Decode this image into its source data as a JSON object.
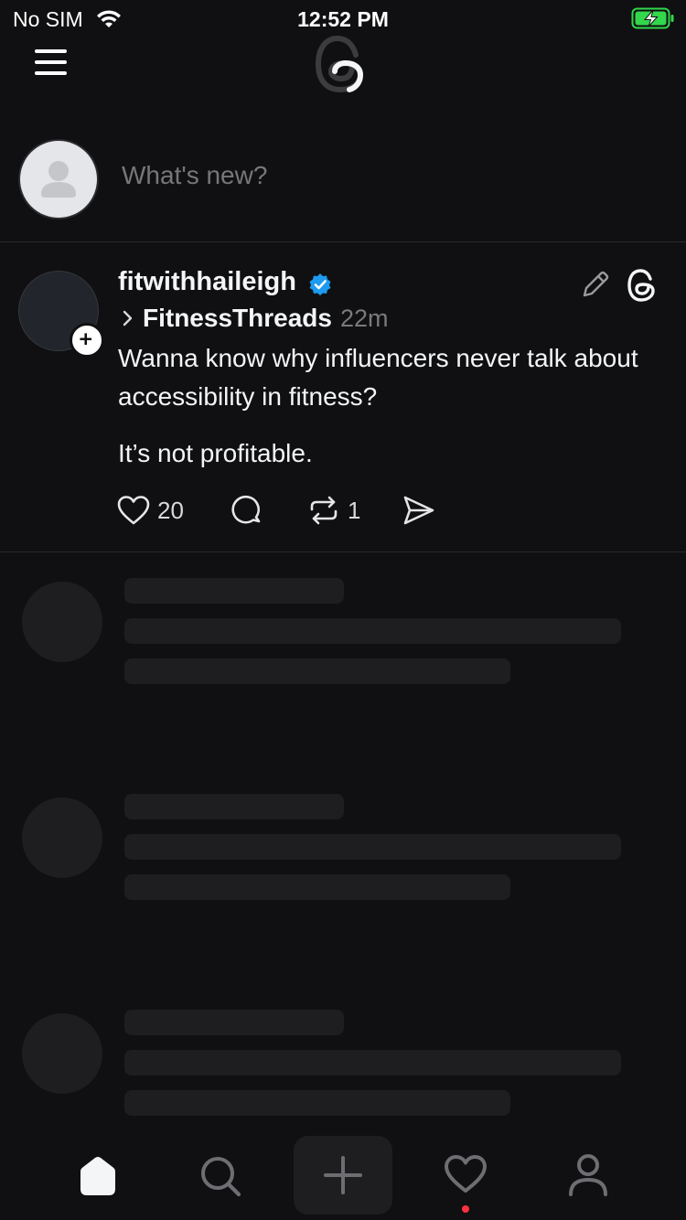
{
  "status_bar": {
    "carrier": "No SIM",
    "time": "12:52 PM"
  },
  "compose": {
    "placeholder": "What's new?"
  },
  "post": {
    "username": "fitwithhaileigh",
    "verified": true,
    "community": "FitnessThreads",
    "time_ago": "22m",
    "text_line1": "Wanna know why influencers never talk about accessibility in fitness?",
    "text_line2": "It’s not profitable.",
    "like_count": "20",
    "repost_count": "1"
  },
  "bottom_nav": {
    "items": [
      "home-icon",
      "search-icon",
      "plus-icon",
      "heart-icon",
      "profile-icon"
    ],
    "active": "home-icon",
    "notification_dot_color": "#ff3040"
  },
  "colors": {
    "background": "#101012",
    "verified_badge": "#1d9bf0",
    "battery_charging": "#32d74b"
  }
}
